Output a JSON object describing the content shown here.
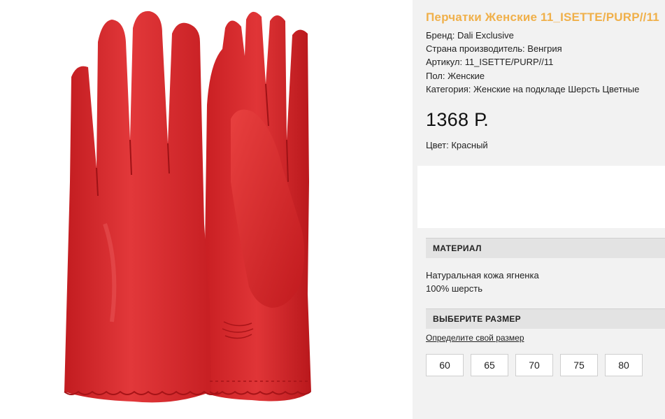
{
  "product": {
    "title": "Перчатки Женские 11_ISETTE/PURP//11",
    "specs": [
      "Бренд: Dali Exclusive",
      "Страна производитель: Венгрия",
      "Артикул: 11_ISETTE/PURP//11",
      "Пол: Женские",
      "Категория: Женские на подкладе Шерсть Цветные"
    ],
    "price": "1368 Р.",
    "color": "Цвет: Красный",
    "image_alt": "red-leather-gloves-photo",
    "accent_color": "#f0b04a",
    "glove_color": "#d8262a"
  },
  "material": {
    "header": "МАТЕРИАЛ",
    "lines": [
      "Натуральная кожа ягненка",
      "100% шерсть"
    ]
  },
  "size": {
    "header": "ВЫБЕРИТЕ РАЗМЕР",
    "link": "Определите свой размер",
    "options": [
      "60",
      "65",
      "70",
      "75",
      "80"
    ]
  }
}
